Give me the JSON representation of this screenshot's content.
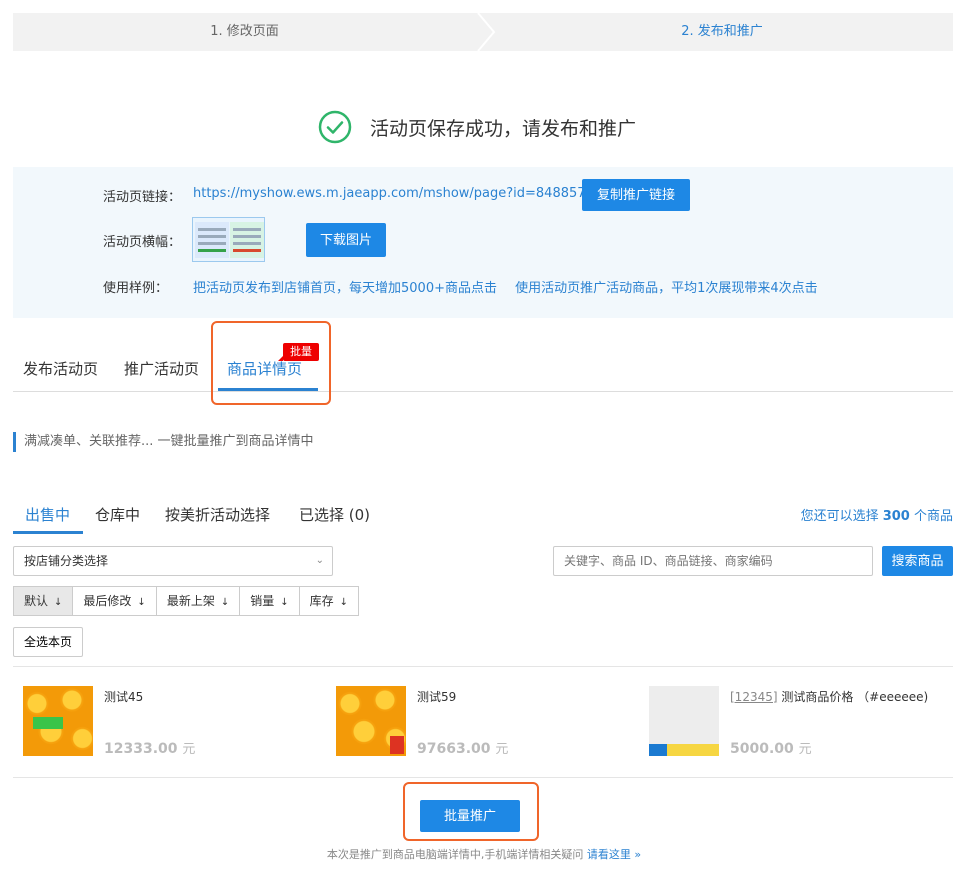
{
  "steps": {
    "step1": "1. 修改页面",
    "step2": "2. 发布和推广"
  },
  "success": {
    "message": "活动页保存成功，请发布和推广",
    "icon": "check-circle-icon",
    "color": "#2fb56a"
  },
  "panel": {
    "link_label": "活动页链接：",
    "link_url": "https://myshow.ews.m.jaeapp.com/mshow/page?id=848857",
    "copy_button": "复制推广链接",
    "banner_label": "活动页横幅：",
    "download_button": "下载图片",
    "example_label": "使用样例：",
    "example_links": [
      "把活动页发布到店铺首页，每天增加5000+商品点击",
      "使用活动页推广活动商品，平均1次展现带来4次点击"
    ]
  },
  "main_tabs": [
    {
      "label": "发布活动页"
    },
    {
      "label": "推广活动页"
    },
    {
      "label": "商品详情页",
      "active": true
    }
  ],
  "badge": "批量",
  "description": "满减凑单、关联推荐... 一键批量推广到商品详情中",
  "sub_tabs": [
    {
      "label": "出售中",
      "active": true
    },
    {
      "label": "仓库中"
    },
    {
      "label": "按美折活动选择"
    },
    {
      "label": "已选择 (0)"
    }
  ],
  "remain": {
    "prefix": "您还可以选择 ",
    "count": "300",
    "suffix": " 个商品"
  },
  "filter": {
    "category_select": "按店铺分类选择",
    "search_placeholder": "关键字、商品 ID、商品链接、商家编码",
    "search_button": "搜索商品"
  },
  "sorts": [
    {
      "label": "默认",
      "active": true
    },
    {
      "label": "最后修改"
    },
    {
      "label": "最新上架"
    },
    {
      "label": "销量"
    },
    {
      "label": "库存"
    }
  ],
  "sort_arrow": "↓",
  "select_all": "全选本页",
  "products": [
    {
      "name": "测试45",
      "price": "12333.00",
      "unit": "元"
    },
    {
      "name": "测试59",
      "price": "97663.00",
      "unit": "元"
    },
    {
      "code": "[12345]",
      "name": " 测试商品价格 （#eeeeee)",
      "price": "5000.00",
      "unit": "元"
    }
  ],
  "batch_button": "批量推广",
  "footer": {
    "note": "本次是推广到商品电脑端详情中,手机端详情相关疑问 ",
    "link": "请看这里 »"
  },
  "colors": {
    "primary": "#1e88e5",
    "link": "#2b82d1",
    "highlight": "#f0652a",
    "badge": "#e00000"
  }
}
